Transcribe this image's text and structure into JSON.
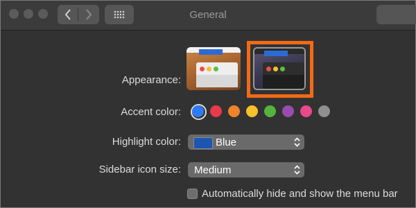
{
  "window": {
    "title": "General"
  },
  "titlebar": {
    "traffic_lights": [
      "close",
      "minimize",
      "zoom"
    ],
    "back_icon": "chevron-left-icon",
    "forward_icon": "chevron-right-icon",
    "show_all_icon": "grid-icon"
  },
  "appearance": {
    "label": "Appearance:",
    "options": [
      {
        "name": "Light",
        "selected": false
      },
      {
        "name": "Dark",
        "selected": true
      }
    ]
  },
  "accent": {
    "label": "Accent color:",
    "colors": [
      "#2d7cf6",
      "#e83a4a",
      "#f0822a",
      "#f6c12b",
      "#55b33d",
      "#9a4cae",
      "#e8498a",
      "#8f8f8f"
    ],
    "selected_index": 0
  },
  "highlight": {
    "label": "Highlight color:",
    "value": "Blue",
    "chip_color": "#1c56b0"
  },
  "sidebar_icon_size": {
    "label": "Sidebar icon size:",
    "value": "Medium"
  },
  "menubar_autohide": {
    "label": "Automatically hide and show the menu bar",
    "checked": false
  },
  "annotation": {
    "color": "#f26a16"
  }
}
